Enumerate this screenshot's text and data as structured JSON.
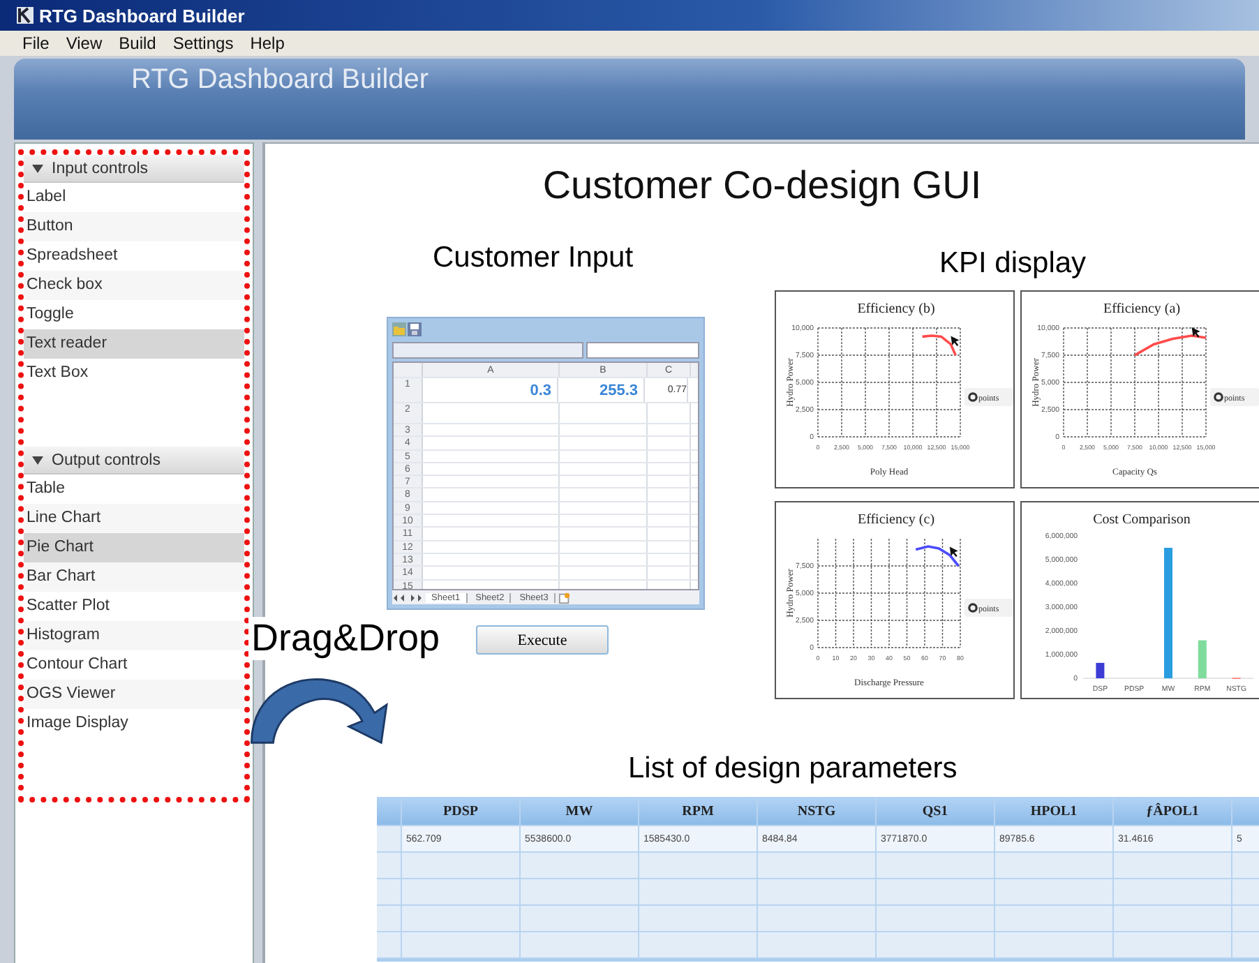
{
  "window": {
    "title": "RTG Dashboard Builder"
  },
  "menu": [
    "File",
    "View",
    "Build",
    "Settings",
    "Help"
  ],
  "banner": {
    "title": "RTG Dashboard Builder"
  },
  "palette": {
    "sections": [
      {
        "title": "Input controls",
        "expanded": true,
        "items": [
          {
            "label": "Label",
            "selected": false
          },
          {
            "label": "Button",
            "selected": false
          },
          {
            "label": "Spreadsheet",
            "selected": false
          },
          {
            "label": "Check box",
            "selected": false
          },
          {
            "label": "Toggle",
            "selected": false
          },
          {
            "label": "Text reader",
            "selected": true
          },
          {
            "label": "Text Box",
            "selected": false
          }
        ]
      },
      {
        "title": "Output controls",
        "expanded": true,
        "items": [
          {
            "label": "Table",
            "selected": false
          },
          {
            "label": "Line Chart",
            "selected": false
          },
          {
            "label": "Pie Chart",
            "selected": true
          },
          {
            "label": "Bar Chart",
            "selected": false
          },
          {
            "label": "Scatter Plot",
            "selected": false
          },
          {
            "label": "Histogram",
            "selected": false
          },
          {
            "label": "Contour Chart",
            "selected": false
          },
          {
            "label": "OGS Viewer",
            "selected": false
          },
          {
            "label": "Image Display",
            "selected": false
          }
        ]
      }
    ]
  },
  "drag_hint": "Drag&Drop",
  "canvas": {
    "heading": "Customer Co-design GUI",
    "input": {
      "title": "Customer Input",
      "spreadsheet": {
        "columns": [
          "A",
          "B",
          "C"
        ],
        "row_numbers": [
          "1",
          "2",
          "3",
          "4",
          "5",
          "6",
          "7",
          "8",
          "9",
          "10",
          "11",
          "12",
          "13",
          "14",
          "15"
        ],
        "first_row": [
          "0.3",
          "255.3",
          "0.77"
        ],
        "sheets": [
          {
            "label": "Sheet1",
            "selected": true
          },
          {
            "label": "Sheet2",
            "selected": false
          },
          {
            "label": "Sheet3",
            "selected": false
          }
        ]
      },
      "button": "Execute"
    },
    "kpi": {
      "title": "KPI display",
      "charts": [
        {
          "chart_data": {
            "type": "line",
            "title": "Efficiency (b)",
            "xlabel": "Poly Head",
            "ylabel": "Hydro Power",
            "grid": true,
            "xlim": [
              0,
              15000
            ],
            "ylim": [
              0,
              10000
            ],
            "xticks": [
              {
                "value": 0,
                "label": "0"
              },
              {
                "value": 2500,
                "label": "2,500"
              },
              {
                "value": 5000,
                "label": "5,000"
              },
              {
                "value": 7500,
                "label": "7,500"
              },
              {
                "value": 10000,
                "label": "10,000"
              },
              {
                "value": 12500,
                "label": "12,500"
              },
              {
                "value": 15000,
                "label": "15,000"
              }
            ],
            "yticks": [
              {
                "value": 0,
                "label": "0"
              },
              {
                "value": 2500,
                "label": "2,500"
              },
              {
                "value": 5000,
                "label": "5,000"
              },
              {
                "value": 7500,
                "label": "7,500"
              },
              {
                "value": 10000,
                "label": "10,000"
              }
            ],
            "x": [
              11000,
              12000,
              13000,
              14000,
              14500
            ],
            "series": [
              {
                "name": "points",
                "color": "#ff4b4b",
                "values": [
                  9200,
                  9300,
                  9200,
                  8500,
                  7500
                ]
              }
            ]
          }
        },
        {
          "chart_data": {
            "type": "line",
            "title": "Efficiency (a)",
            "xlabel": "Capacity Qs",
            "ylabel": "Hydro Power",
            "grid": true,
            "xlim": [
              0,
              15000
            ],
            "ylim": [
              0,
              10000
            ],
            "xticks": [
              {
                "value": 0,
                "label": "0"
              },
              {
                "value": 2500,
                "label": "2,500"
              },
              {
                "value": 5000,
                "label": "5,000"
              },
              {
                "value": 7500,
                "label": "7,500"
              },
              {
                "value": 10000,
                "label": "10,000"
              },
              {
                "value": 12500,
                "label": "12,500"
              },
              {
                "value": 15000,
                "label": "15,000"
              }
            ],
            "yticks": [
              {
                "value": 0,
                "label": "0"
              },
              {
                "value": 2500,
                "label": "2,500"
              },
              {
                "value": 5000,
                "label": "5,000"
              },
              {
                "value": 7500,
                "label": "7,500"
              },
              {
                "value": 10000,
                "label": "10,000"
              }
            ],
            "x": [
              7500,
              9500,
              11500,
              13500,
              15000
            ],
            "series": [
              {
                "name": "points",
                "color": "#ff4b4b",
                "values": [
                  7500,
                  8500,
                  9000,
                  9300,
                  9100
                ]
              }
            ]
          }
        },
        {
          "chart_data": {
            "type": "line",
            "title": "Efficiency (c)",
            "xlabel": "Discharge Pressure",
            "ylabel": "Hydro Power",
            "grid": true,
            "xlim": [
              0,
              80
            ],
            "ylim": [
              0,
              10000
            ],
            "xticks": [
              0,
              10,
              20,
              30,
              40,
              50,
              60,
              70,
              80
            ],
            "yticks": [
              {
                "value": 0,
                "label": "0"
              },
              {
                "value": 2500,
                "label": "2,500"
              },
              {
                "value": 5000,
                "label": "5,000"
              },
              {
                "value": 7500,
                "label": "7,500"
              }
            ],
            "x": [
              55,
              62,
              68,
              74,
              79
            ],
            "series": [
              {
                "name": "points",
                "color": "#4b4bff",
                "values": [
                  9000,
                  9300,
                  9100,
                  8500,
                  7500
                ]
              }
            ]
          }
        },
        {
          "chart_data": {
            "type": "bar",
            "title": "Cost Comparison",
            "categories": [
              "DSP",
              "PDSP",
              "MW",
              "RPM",
              "NSTG"
            ],
            "ylim": [
              0,
              6000000
            ],
            "yticks": [
              {
                "value": 0,
                "label": "0"
              },
              {
                "value": 1000000,
                "label": "1,000,000"
              },
              {
                "value": 2000000,
                "label": "2,000,000"
              },
              {
                "value": 3000000,
                "label": "3,000,000"
              },
              {
                "value": 4000000,
                "label": "4,000,000"
              },
              {
                "value": 5000000,
                "label": "5,000,000"
              },
              {
                "value": 6000000,
                "label": "6,000,000"
              }
            ],
            "values": [
              650000,
              0,
              5500000,
              1600000,
              20000
            ],
            "colors": [
              "#3d3dd6",
              "#2a9de0",
              "#2a9de0",
              "#7fdc9c",
              "#ff7a7a"
            ]
          }
        }
      ]
    },
    "params": {
      "title": "List of design parameters",
      "table": {
        "columns": [
          "PDSP",
          "MW",
          "RPM",
          "NSTG",
          "QS1",
          "HPOL1",
          "ƒÂPOL1"
        ],
        "rows": [
          {
            "cells": [
              "562.709",
              "5538600.0",
              "1585430.0",
              "8484.84",
              "3771870.0",
              "89785.6",
              "31.4616",
              "5"
            ]
          }
        ]
      }
    }
  }
}
